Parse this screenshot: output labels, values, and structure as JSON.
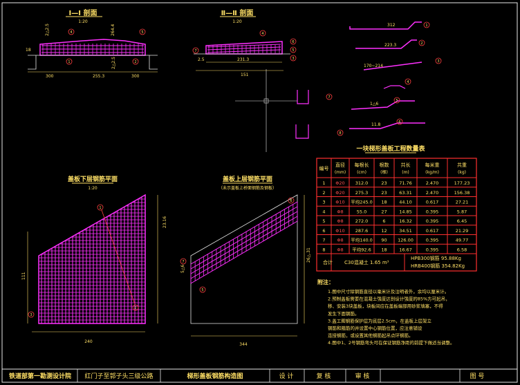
{
  "colors": {
    "background": "#000000",
    "frame": "#e8e8e8",
    "title": "#ffe066",
    "rebar": "#ff30ff",
    "dimension": "#ffe066",
    "callout": "#ff4040",
    "table_line": "#ff3030",
    "text": "#ffffff"
  },
  "views": {
    "section_1": {
      "title": "Ⅰ—Ⅰ 剖面",
      "scale": "1:20"
    },
    "section_2": {
      "title": "Ⅱ—Ⅱ 剖面",
      "scale": "1:20"
    },
    "bottom_plan": {
      "title": "盖板下层钢筋平面",
      "scale": "1:20"
    },
    "top_plan": {
      "title": "盖板上层钢筋平面",
      "note": "（未示盖板上桥面钢筋及钢板）"
    }
  },
  "dims": {
    "s1_top": "264.4",
    "s1_left": "2△2.5",
    "s1_right": "2△2.5",
    "s1_bottom_left": "300",
    "s1_bottom_mid": "255.3",
    "s1_bottom_right": "300",
    "s1_span": "18",
    "s2_a": "2.5",
    "s2_b": "231.3",
    "s2_c": "151",
    "bp_h1": "23.16",
    "bp_h2": "111",
    "bp_w": "240",
    "tp_w": "344",
    "tp_h": "26△.31",
    "tp_d": "5△6"
  },
  "rebar_shapes": [
    {
      "id": "1",
      "dim": "312"
    },
    {
      "id": "2",
      "dim": "223.3"
    },
    {
      "id": "3",
      "dim": "170~214"
    },
    {
      "id": "4",
      "dim": "1△4"
    },
    {
      "id": "5",
      "dim": "1△6"
    },
    {
      "id": "6",
      "dim": "11.8"
    }
  ],
  "table": {
    "title": "一块梯形盖板工程数量表",
    "headers": [
      "编号",
      "直径\n(mm)",
      "每根长\n(cm)",
      "根数\n(根)",
      "共长\n(m)",
      "每米重\n(kg/m)",
      "共重\n(kg)"
    ],
    "rows": [
      [
        "1",
        "Φ20",
        "312.0",
        "23",
        "71.76",
        "2.470",
        "177.23"
      ],
      [
        "2",
        "Φ20",
        "275.3",
        "23",
        "63.31",
        "2.470",
        "156.38"
      ],
      [
        "3",
        "Φ10",
        "平均245.0",
        "18",
        "44.10",
        "0.617",
        "27.21"
      ],
      [
        "4",
        "Φ8",
        "55.0",
        "27",
        "14.85",
        "0.395",
        "5.87"
      ],
      [
        "5",
        "Φ8",
        "272.0",
        "6",
        "16.32",
        "0.395",
        "6.45"
      ],
      [
        "6",
        "Φ10",
        "287.6",
        "12",
        "34.51",
        "0.617",
        "21.29"
      ],
      [
        "7",
        "Φ8",
        "平均140.0",
        "90",
        "126.00",
        "0.395",
        "49.77"
      ],
      [
        "8",
        "Φ8",
        "平均92.6",
        "18",
        "16.67",
        "0.395",
        "6.58"
      ]
    ],
    "total_label": "合计",
    "concrete": "C30混凝土 1.65 m³",
    "hpb": "HPB300钢筋 95.88Kg",
    "hrb": "HRB400钢筋 354.82Kg"
  },
  "notes": {
    "title": "附注：",
    "lines": [
      "1.图中尺寸除钢筋直径以毫米计及注明者外，余均以厘米计。",
      "2.预制盖板需要在混凝土强度达到设计强度的85%方可起吊，",
      "  移、安装3块盖板，块板间应在盖板端部用砂浆填塞，不得",
      "  发生下面钢筋。",
      "3.盖工图钢筋保护层为底层2.5cm，在盖板上层架立",
      "  钢筋和箍筋的并设置中心钢筋位置，应注意铺设",
      "  连接钢筋，或设置其他钢筋起吊点环钢筋。",
      "4.图中1、2号钢筋弯头可在保证钢筋净距的前提下做适当调整。"
    ]
  },
  "titlebar": {
    "org": "铁道部第一勘测设计院",
    "project": "红门子至郭子头三级公路",
    "drawing": "梯形盖板钢筋构造图",
    "design": "设 计",
    "review": "复 核",
    "approve": "审 核",
    "sheet": "图 号"
  }
}
